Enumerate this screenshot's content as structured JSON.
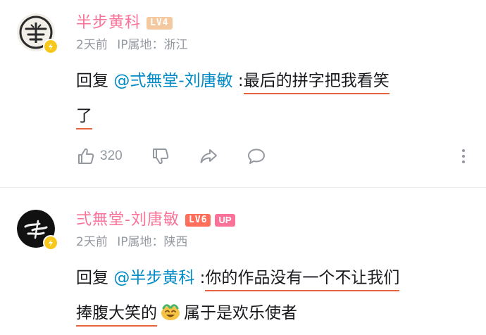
{
  "comments": [
    {
      "username": "半步黄科",
      "level": "LV4",
      "time": "2天前",
      "ip": "IP属地：浙江",
      "reply_prefix": "回复",
      "mention": "@弍無堂-刘唐敏",
      "colon": " :",
      "text_highlight_1": "最后的拼字把我看笑",
      "text_highlight_2": "了",
      "likes": "320"
    },
    {
      "username": "弍無堂-刘唐敏",
      "level": "LV6",
      "up_badge": "UP",
      "time": "2天前",
      "ip": "IP属地：陕西",
      "reply_prefix": "回复",
      "mention": "@半步黄科",
      "colon": " :",
      "text_highlight_1": "你的作品没有一个不让我们",
      "text_highlight_2": "捧腹大笑的",
      "emoji": "laughing-face-emoji",
      "text_plain": "属于是欢乐使者"
    }
  ],
  "colors": {
    "username": "#fb7299",
    "mention": "#008ac5",
    "highlight_underline": "#e7623d",
    "meta": "#9499a0",
    "vip_badge": "#f8c71b"
  },
  "icons": [
    "thumbs-up-icon",
    "thumbs-down-icon",
    "share-icon",
    "reply-icon",
    "more-icon",
    "lightning-icon"
  ]
}
